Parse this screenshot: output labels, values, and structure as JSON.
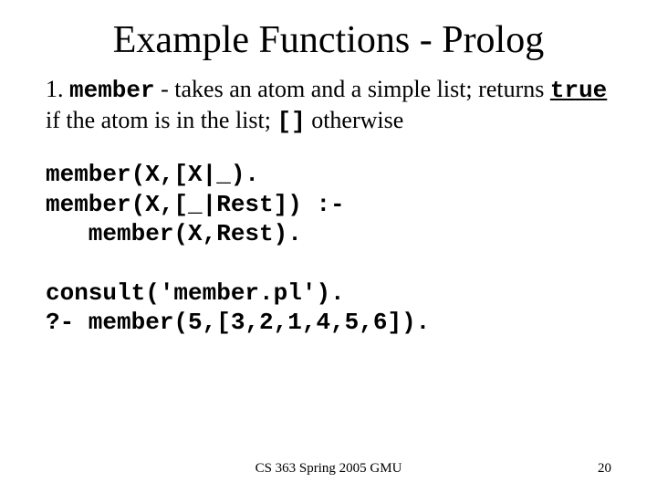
{
  "title": "Example Functions - Prolog",
  "desc": {
    "num": "1. ",
    "name": "member",
    "dash": " - takes an atom and a simple list; returns ",
    "truetxt": "true",
    "mid": " if the atom is in the list; ",
    "empty": "[]",
    "end": " otherwise"
  },
  "code1_l1": "member(X,[X|_).",
  "code1_l2": "member(X,[_|Rest]) :-",
  "code1_l3": "   member(X,Rest).",
  "code2_l1": "consult('member.pl').",
  "code2_l2": "?- member(5,[3,2,1,4,5,6]).",
  "footer": "CS 363 Spring 2005 GMU",
  "pagenum": "20"
}
